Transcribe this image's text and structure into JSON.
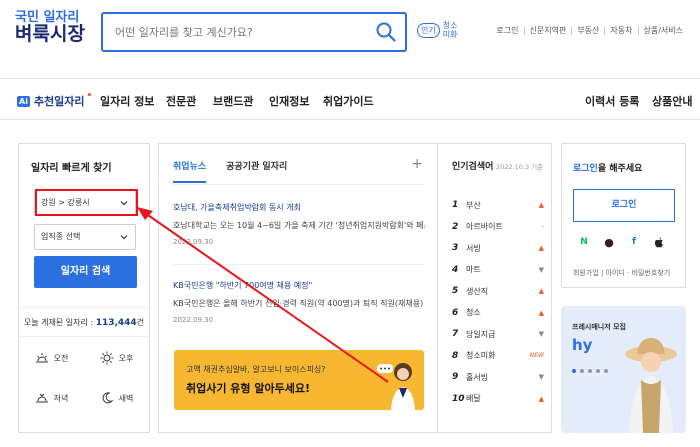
{
  "header": {
    "logo_line1": "국민 일자리",
    "logo_line2": "벼룩시장",
    "search_placeholder": "어떤 일자리를 찾고 계신가요?",
    "popular_badge": "인기",
    "popular_rotating_1": "청소",
    "popular_rotating_2": "미화",
    "top_links": [
      "로그인",
      "신문지역판",
      "부동산",
      "자동차",
      "상품/서비스"
    ]
  },
  "nav": {
    "ai_box": "Ai",
    "ai_label": "추천일자리",
    "items": [
      "일자리 정보",
      "전문관",
      "브랜드관",
      "인재정보",
      "취업가이드"
    ],
    "right_items": [
      "이력서 등록",
      "상품안내"
    ]
  },
  "quick": {
    "title": "일자리 빠르게 찾기",
    "region_value": "강원 > 강릉시",
    "job_value": "업직종 선택",
    "search_button": "일자리 검색",
    "today_label": "오늘 게재된 일자리 :",
    "today_count": "113,444",
    "today_unit": "건",
    "times": [
      "오전",
      "오후",
      "저녁",
      "새벽"
    ]
  },
  "news": {
    "tabs": [
      "취업뉴스",
      "공공기관 일자리"
    ],
    "items": [
      {
        "headline": "호남대, 가을축제취업박람회 동시 개최",
        "body": "호남대학교는 오는 10월 4~6일 가을 축제 기간 '청년취업지원박람회'와 페스티...",
        "date": "2022.09.30"
      },
      {
        "headline": "KB국민은행 \"하반기 700여명 채용 예정\"",
        "body": "KB국민은행은 올해 하반기 신입·경력 직원(약 400명)과 퇴직 직원(재채용) 등 70...",
        "date": "2022.09.30"
      }
    ],
    "banner_sub": "고액 채권추심알바, 알고보니 보이스피싱?",
    "banner_title": "취업사기 유형 알아두세요!"
  },
  "popular": {
    "title": "인기검색어",
    "date": "2022.10.3 기준",
    "items": [
      {
        "rank": "1",
        "word": "부산",
        "trend": "▲",
        "kind": "up"
      },
      {
        "rank": "2",
        "word": "아르바이트",
        "trend": "-",
        "kind": "dn"
      },
      {
        "rank": "3",
        "word": "서빙",
        "trend": "▲",
        "kind": "up"
      },
      {
        "rank": "4",
        "word": "마트",
        "trend": "▼",
        "kind": "dn"
      },
      {
        "rank": "5",
        "word": "생산직",
        "trend": "▲",
        "kind": "up"
      },
      {
        "rank": "6",
        "word": "청소",
        "trend": "▲",
        "kind": "up"
      },
      {
        "rank": "7",
        "word": "당일지급",
        "trend": "▼",
        "kind": "dn"
      },
      {
        "rank": "8",
        "word": "청소미화",
        "trend": "NEW",
        "kind": "nw"
      },
      {
        "rank": "9",
        "word": "홀서빙",
        "trend": "▼",
        "kind": "dn"
      },
      {
        "rank": "10",
        "word": "배달",
        "trend": "▲",
        "kind": "up"
      }
    ]
  },
  "login": {
    "title_accent": "로그인",
    "title_rest": "을 해주세요",
    "button": "로그인",
    "social": [
      "N",
      "●",
      "f",
      ""
    ],
    "links": "회원가입 | 아이디 · 비밀번호찾기"
  },
  "promo": {
    "sub": "프레시매니저 모집",
    "headline": "hy"
  },
  "colors": {
    "brand": "#2b6fe0",
    "navy": "#1b2a6e",
    "annotation": "#e8161b",
    "banner": "#f7b731"
  }
}
